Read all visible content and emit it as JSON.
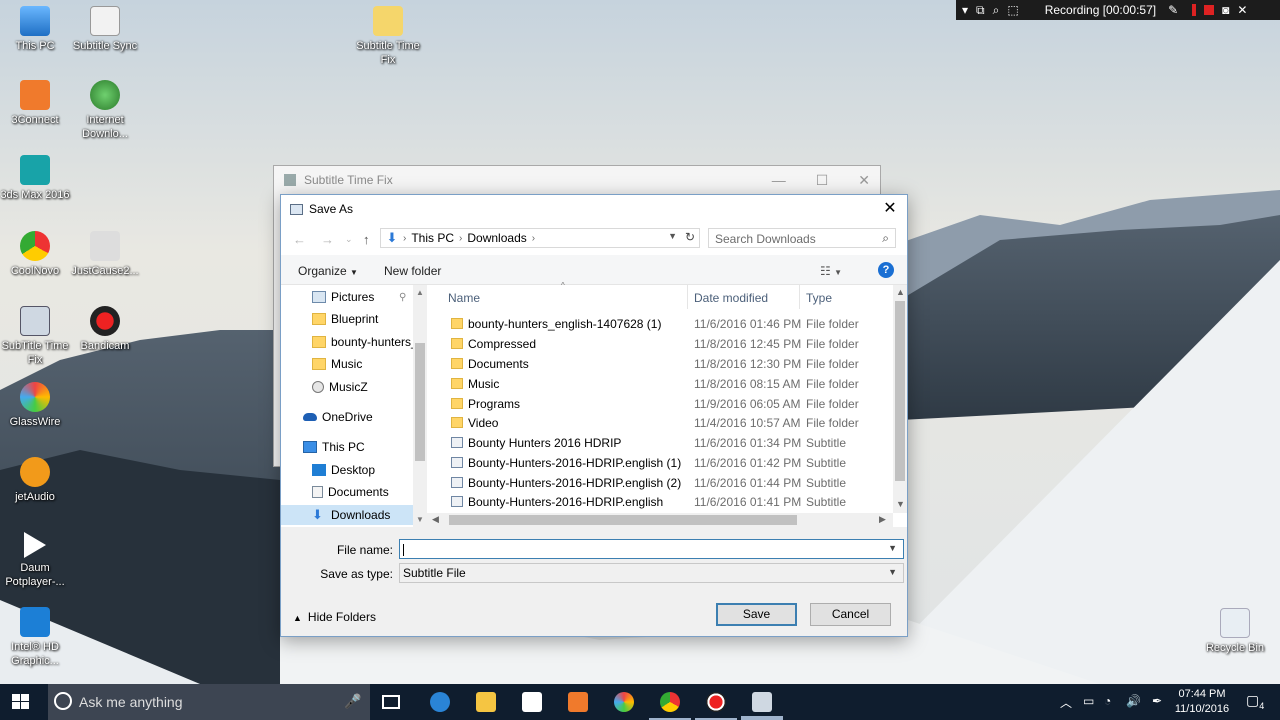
{
  "recording": {
    "label": "Recording [00:00:57]"
  },
  "desktop_icons": [
    {
      "label": "This PC"
    },
    {
      "label": "Subtitle Sync"
    },
    {
      "label": "Subtitle Time Fix"
    },
    {
      "label": "3Connect"
    },
    {
      "label": "Internet Downlo..."
    },
    {
      "label": "3ds Max 2016"
    },
    {
      "label": "CoolNovo"
    },
    {
      "label": "JustCause2..."
    },
    {
      "label": "SubTitle Time Fix"
    },
    {
      "label": "Bandicam"
    },
    {
      "label": "GlassWire"
    },
    {
      "label": "jetAudio"
    },
    {
      "label": "Daum Potplayer-..."
    },
    {
      "label": "Intel® HD Graphic..."
    },
    {
      "label": "Recycle Bin"
    }
  ],
  "background_window": {
    "title": "Subtitle Time Fix"
  },
  "dialog": {
    "title": "Save As",
    "address": {
      "segments": [
        "This PC",
        "Downloads"
      ]
    },
    "search_placeholder": "Search Downloads",
    "toolbar": {
      "organize": "Organize",
      "new_folder": "New folder"
    },
    "nav_items": [
      {
        "label": "Pictures",
        "icon": "pictures-icon"
      },
      {
        "label": "Blueprint",
        "icon": "folder-icon"
      },
      {
        "label": "bounty-hunters_",
        "icon": "folder-icon"
      },
      {
        "label": "Music",
        "icon": "folder-icon"
      },
      {
        "label": "MusicZ",
        "icon": "music-folder-icon"
      },
      {
        "label": "OneDrive",
        "icon": "onedrive-icon"
      },
      {
        "label": "This PC",
        "icon": "this-pc-icon"
      },
      {
        "label": "Desktop",
        "icon": "desktop-icon"
      },
      {
        "label": "Documents",
        "icon": "documents-icon"
      },
      {
        "label": "Downloads",
        "icon": "downloads-icon"
      }
    ],
    "columns": {
      "name": "Name",
      "date": "Date modified",
      "type": "Type"
    },
    "files": [
      {
        "name": "bounty-hunters_english-1407628 (1)",
        "date": "11/6/2016 01:46 PM",
        "type": "File folder",
        "kind": "folder"
      },
      {
        "name": "Compressed",
        "date": "11/8/2016 12:45 PM",
        "type": "File folder",
        "kind": "folder"
      },
      {
        "name": "Documents",
        "date": "11/8/2016 12:30 PM",
        "type": "File folder",
        "kind": "folder"
      },
      {
        "name": "Music",
        "date": "11/8/2016 08:15 AM",
        "type": "File folder",
        "kind": "folder"
      },
      {
        "name": "Programs",
        "date": "11/9/2016 06:05 AM",
        "type": "File folder",
        "kind": "folder"
      },
      {
        "name": "Video",
        "date": "11/4/2016 10:57 AM",
        "type": "File folder",
        "kind": "folder"
      },
      {
        "name": "Bounty Hunters 2016 HDRIP",
        "date": "11/6/2016 01:34 PM",
        "type": "Subtitle",
        "kind": "subtitle"
      },
      {
        "name": "Bounty-Hunters-2016-HDRIP.english (1)",
        "date": "11/6/2016 01:42 PM",
        "type": "Subtitle",
        "kind": "subtitle"
      },
      {
        "name": "Bounty-Hunters-2016-HDRIP.english (2)",
        "date": "11/6/2016 01:44 PM",
        "type": "Subtitle",
        "kind": "subtitle"
      },
      {
        "name": "Bounty-Hunters-2016-HDRIP.english",
        "date": "11/6/2016 01:41 PM",
        "type": "Subtitle",
        "kind": "subtitle"
      }
    ],
    "file_name_label": "File name:",
    "file_name_value": "",
    "save_as_type_label": "Save as type:",
    "save_as_type_value": "Subtitle File",
    "hide_folders": "Hide Folders",
    "save": "Save",
    "cancel": "Cancel"
  },
  "taskbar": {
    "search_text": "Ask me anything",
    "clock_time": "07:44 PM",
    "clock_date": "11/10/2016",
    "notification_count": "4"
  }
}
